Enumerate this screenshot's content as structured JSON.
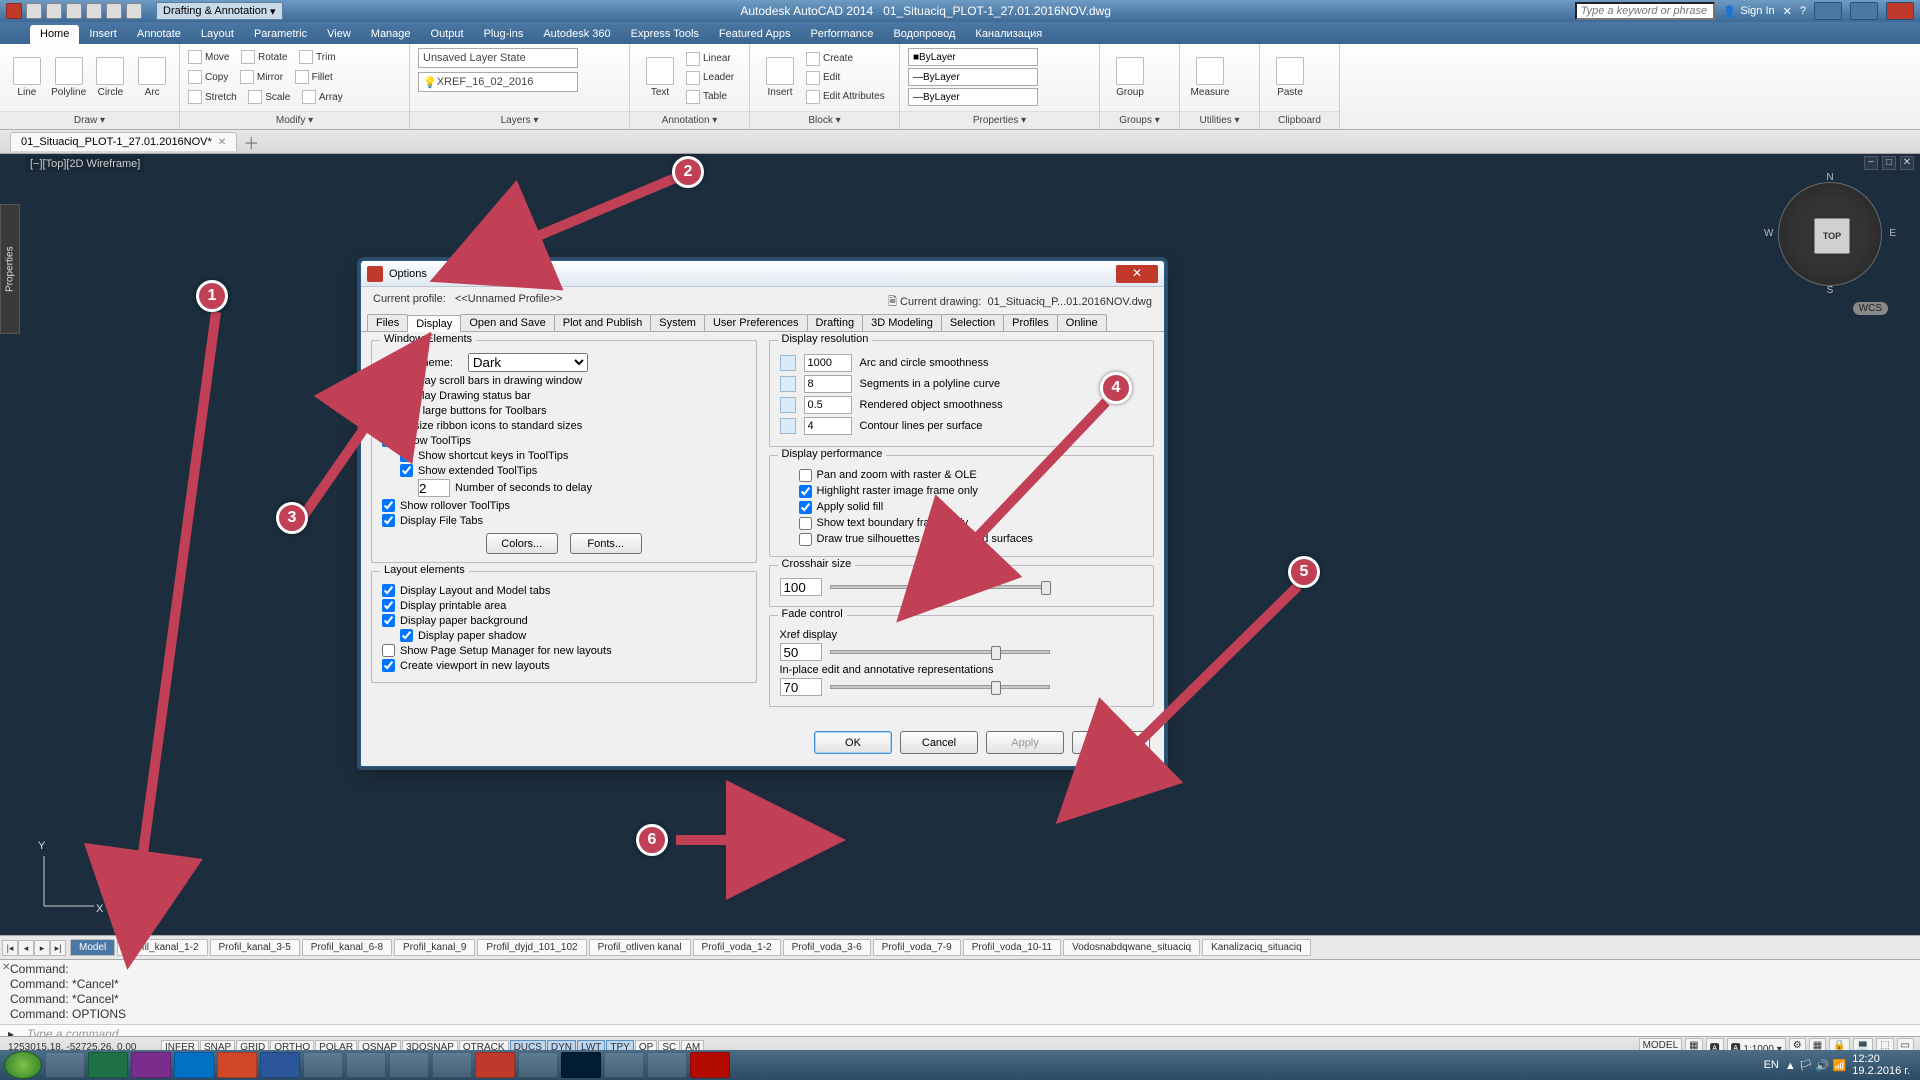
{
  "title": {
    "app": "Autodesk AutoCAD 2014",
    "file": "01_Situaciq_PLOT-1_27.01.2016NOV.dwg",
    "workspace": "Drafting & Annotation",
    "search_placeholder": "Type a keyword or phrase",
    "signin": "Sign In"
  },
  "ribbon_tabs": [
    "Home",
    "Insert",
    "Annotate",
    "Layout",
    "Parametric",
    "View",
    "Manage",
    "Output",
    "Plug-ins",
    "Autodesk 360",
    "Express Tools",
    "Featured Apps",
    "Performance",
    "Водопровод",
    "Канализация"
  ],
  "ribbon_active_tab": "Home",
  "ribbon": {
    "draw": {
      "title": "Draw ▾",
      "items": [
        "Line",
        "Polyline",
        "Circle",
        "Arc"
      ]
    },
    "modify": {
      "title": "Modify ▾",
      "rows": [
        [
          "Move",
          "Rotate",
          "Trim"
        ],
        [
          "Copy",
          "Mirror",
          "Fillet"
        ],
        [
          "Stretch",
          "Scale",
          "Array"
        ]
      ]
    },
    "layers": {
      "title": "Layers ▾",
      "state": "Unsaved Layer State",
      "current": "XREF_16_02_2016"
    },
    "annotation": {
      "title": "Annotation ▾",
      "btn": "Text",
      "rows": [
        "Linear",
        "Leader",
        "Table"
      ]
    },
    "block": {
      "title": "Block ▾",
      "btn": "Insert",
      "rows": [
        "Create",
        "Edit",
        "Edit Attributes"
      ]
    },
    "properties": {
      "title": "Properties ▾",
      "rows": [
        "ByLayer",
        "ByLayer",
        "ByLayer"
      ]
    },
    "groups": {
      "title": "Groups ▾",
      "btn": "Group"
    },
    "utilities": {
      "title": "Utilities ▾",
      "btn": "Measure"
    },
    "clipboard": {
      "title": "Clipboard",
      "btn": "Paste"
    }
  },
  "filetab": "01_Situaciq_PLOT-1_27.01.2016NOV*",
  "viewport_label": "[−][Top][2D Wireframe]",
  "viewcube": {
    "face": "TOP",
    "n": "N",
    "s": "S",
    "e": "E",
    "w": "W",
    "wcs": "WCS"
  },
  "ucs": {
    "x": "X",
    "y": "Y"
  },
  "side_prop": "Properties",
  "layout_tabs": [
    "Model",
    "Profil_kanal_1-2",
    "Profil_kanal_3-5",
    "Profil_kanal_6-8",
    "Profil_kanal_9",
    "Profil_dyjd_101_102",
    "Profil_otliven kanal",
    "Profil_voda_1-2",
    "Profil_voda_3-6",
    "Profil_voda_7-9",
    "Profil_voda_10-11",
    "Vodosnabdqwane_situaciq",
    "Kanalizaciq_situaciq"
  ],
  "cmd_history": [
    "Command:",
    "Command: *Cancel*",
    "Command: *Cancel*",
    "Command: OPTIONS"
  ],
  "cmd_placeholder": "Type a command",
  "status": {
    "coords": "1253015.18, -52725.26, 0.00",
    "toggles": [
      "INFER",
      "SNAP",
      "GRID",
      "ORTHO",
      "POLAR",
      "OSNAP",
      "3DOSNAP",
      "OTRACK",
      "DUCS",
      "DYN",
      "LWT",
      "TPY",
      "QP",
      "SC",
      "AM"
    ],
    "toggles_on": [
      "DUCS",
      "DYN",
      "LWT",
      "TPY"
    ],
    "model": "MODEL",
    "scale": "1:1000"
  },
  "taskbar": {
    "time": "12:20",
    "date": "19.2.2016 г.",
    "lang": "EN"
  },
  "dialog": {
    "title": "Options",
    "profile_label": "Current profile:",
    "profile_value": "<<Unnamed Profile>>",
    "drawing_label": "Current drawing:",
    "drawing_value": "01_Situaciq_P...01.2016NOV.dwg",
    "tabs": [
      "Files",
      "Display",
      "Open and Save",
      "Plot and Publish",
      "System",
      "User Preferences",
      "Drafting",
      "3D Modeling",
      "Selection",
      "Profiles",
      "Online"
    ],
    "active_tab": "Display",
    "window_elements": {
      "title": "Window Elements",
      "color_scheme_label": "Color scheme:",
      "color_scheme_value": "Dark",
      "cb_scroll": "Display scroll bars in drawing window",
      "cb_status": "Display Drawing status bar",
      "cb_largebtns": "Use large buttons for Toolbars",
      "cb_resize": "Resize ribbon icons to standard sizes",
      "cb_tooltips": "Show ToolTips",
      "cb_shortcut": "Show shortcut keys in ToolTips",
      "cb_ext": "Show extended ToolTips",
      "delay_label": "Number of seconds to delay",
      "delay_value": "2",
      "cb_roll": "Show rollover ToolTips",
      "cb_filetabs": "Display File Tabs",
      "btn_colors": "Colors...",
      "btn_fonts": "Fonts..."
    },
    "layout_elements": {
      "title": "Layout elements",
      "cb_tabs": "Display Layout and Model tabs",
      "cb_print": "Display printable area",
      "cb_bg": "Display paper background",
      "cb_shadow": "Display paper shadow",
      "cb_psm": "Show Page Setup Manager for new layouts",
      "cb_vp": "Create viewport in new layouts"
    },
    "display_res": {
      "title": "Display resolution",
      "r1": {
        "val": "1000",
        "label": "Arc and circle smoothness"
      },
      "r2": {
        "val": "8",
        "label": "Segments in a polyline curve"
      },
      "r3": {
        "val": "0.5",
        "label": "Rendered object smoothness"
      },
      "r4": {
        "val": "4",
        "label": "Contour lines per surface"
      }
    },
    "display_perf": {
      "title": "Display performance",
      "cb_pan": "Pan and zoom with raster & OLE",
      "cb_hilite": "Highlight raster image frame only",
      "cb_solid": "Apply solid fill",
      "cb_textb": "Show text boundary frame only",
      "cb_silh": "Draw true silhouettes for solids and surfaces"
    },
    "crosshair": {
      "title": "Crosshair size",
      "val": "100"
    },
    "fade": {
      "title": "Fade control",
      "xref_label": "Xref display",
      "xref_val": "50",
      "inplace_label": "In-place edit and annotative representations",
      "inplace_val": "70"
    },
    "footer": {
      "ok": "OK",
      "cancel": "Cancel",
      "apply": "Apply",
      "help": "Help"
    }
  },
  "annotations": {
    "1": "1",
    "2": "2",
    "3": "3",
    "4": "4",
    "5": "5",
    "6": "6"
  }
}
